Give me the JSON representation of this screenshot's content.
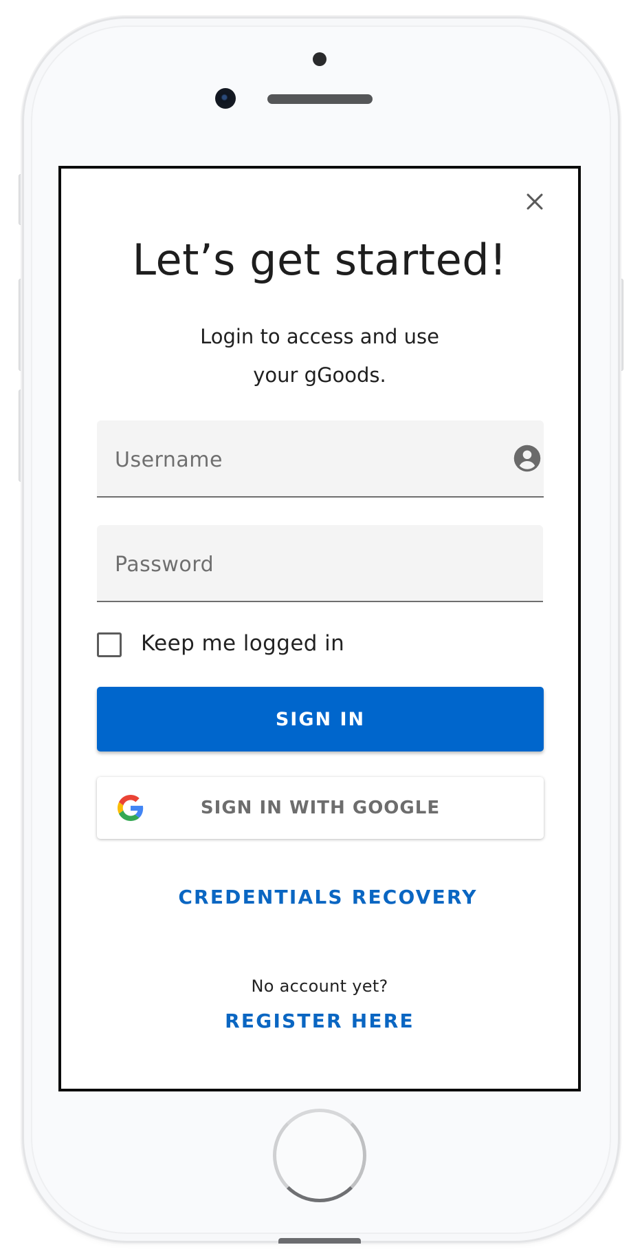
{
  "login": {
    "title": "Let’s get started!",
    "subtitle": "Login to access and use your gGoods.",
    "username_placeholder": "Username",
    "password_placeholder": "Password",
    "keep_logged_in_label": "Keep me logged in",
    "keep_logged_in_checked": false,
    "signin_label": "SIGN IN",
    "google_label": "SIGN IN WITH GOOGLE",
    "recovery_label": "CREDENTIALS RECOVERY",
    "no_account_text": "No account yet?",
    "register_label": "REGISTER HERE"
  },
  "icons": {
    "close": "close-icon",
    "user": "account-circle-icon",
    "google": "google-logo-icon",
    "checkbox": "checkbox-unchecked-icon"
  },
  "colors": {
    "primary": "#0066cc",
    "link": "#0a66c2",
    "field_background": "#f4f4f4",
    "text": "#1e1e1e",
    "muted_text": "#6d6d6d"
  }
}
